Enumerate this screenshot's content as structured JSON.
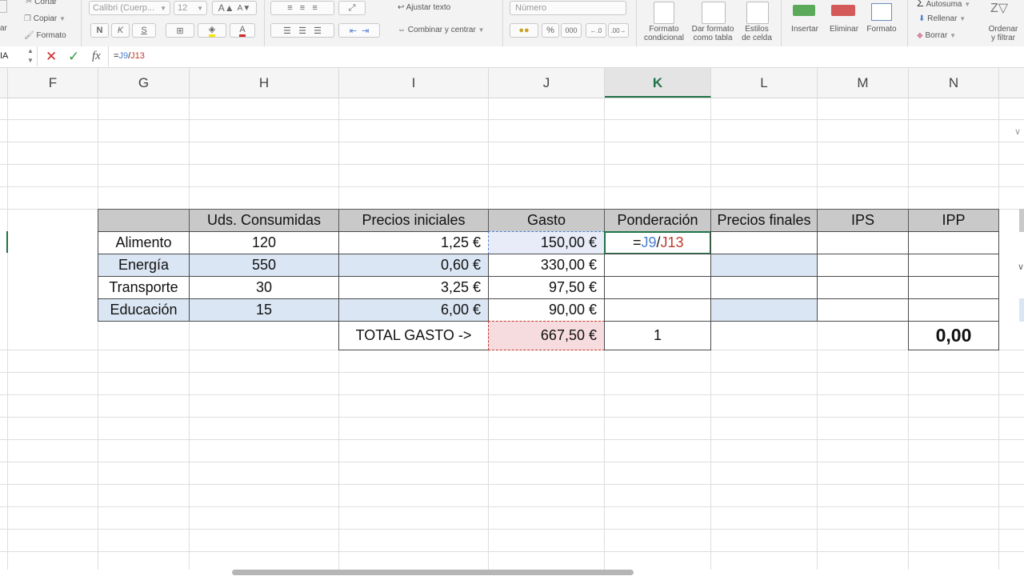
{
  "ribbon": {
    "clipboard": {
      "cut": "Cortar",
      "copy": "Copiar",
      "format": "Formato",
      "left_partial": "ar"
    },
    "font": {
      "name": "Calibri (Cuerp...",
      "size": "12",
      "bold": "N",
      "italic": "K",
      "underline": "S"
    },
    "alignment": {
      "wrap_text": "Ajustar texto",
      "merge_center": "Combinar y centrar"
    },
    "number": {
      "format": "Número",
      "percent": "%",
      "thousands": "000"
    },
    "styles": {
      "conditional_l1": "Formato",
      "conditional_l2": "condicional",
      "table_l1": "Dar formato",
      "table_l2": "como tabla",
      "cell_l1": "Estilos",
      "cell_l2": "de celda"
    },
    "cells": {
      "insert": "Insertar",
      "delete": "Eliminar",
      "format": "Formato"
    },
    "editing": {
      "autosum": "Autosuma",
      "fill": "Rellenar",
      "clear": "Borrar",
      "sort_l1": "Ordenar",
      "sort_l2": "y filtrar"
    }
  },
  "formula_bar": {
    "name_box": "IA",
    "fx": "fx",
    "formula_parts": {
      "eq": "=",
      "ref1": "J9",
      "slash": "/",
      "ref2": "J13"
    }
  },
  "columns": [
    "F",
    "G",
    "H",
    "I",
    "J",
    "K",
    "L",
    "M",
    "N"
  ],
  "active_column": "K",
  "table": {
    "headers": [
      "",
      "Uds. Consumidas",
      "Precios iniciales",
      "Gasto",
      "Ponderación",
      "Precios finales",
      "IPS",
      "IPP"
    ],
    "rows": [
      {
        "item": "Alimento",
        "units": "120",
        "price": "1,25 €",
        "spend": "150,00 €"
      },
      {
        "item": "Energía",
        "units": "550",
        "price": "0,60 €",
        "spend": "330,00 €"
      },
      {
        "item": "Transporte",
        "units": "30",
        "price": "3,25 €",
        "spend": "97,50 €"
      },
      {
        "item": "Educación",
        "units": "15",
        "price": "6,00 €",
        "spend": "90,00 €"
      }
    ],
    "editing_cell": {
      "eq": "=",
      "ref1": "J9",
      "slash": "/",
      "ref2": "J13"
    },
    "total_label": "TOTAL GASTO ->",
    "total_value": "667,50 €",
    "weight_total": "1",
    "ipp_total": "0,00"
  },
  "colors": {
    "ref1": "#4a7fcf",
    "ref2": "#c0392b",
    "header_fill": "#c9c9c9",
    "row_fill": "#dbe6f4",
    "total_fill": "#f6dcdf",
    "active_green": "#217346"
  }
}
